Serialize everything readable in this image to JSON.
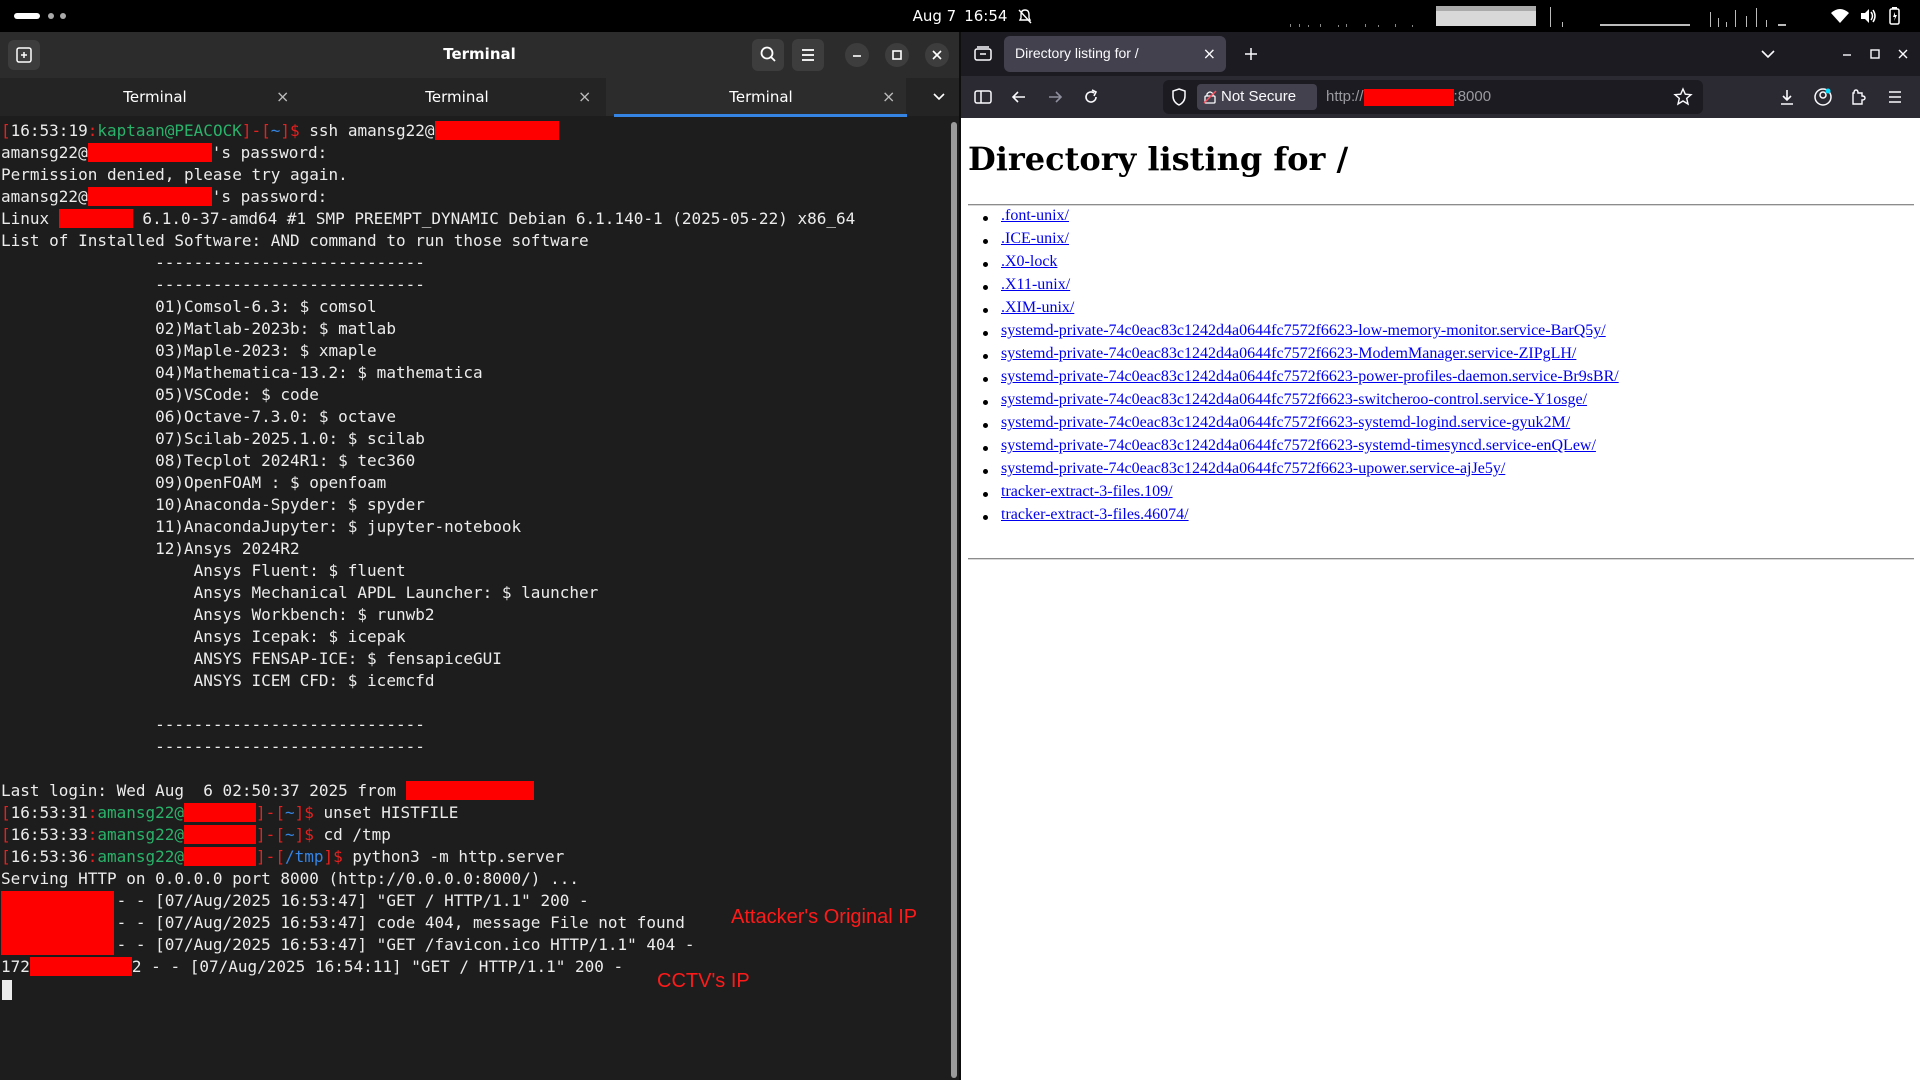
{
  "topbar": {
    "date": "Aug 7",
    "time": "16:54"
  },
  "terminal": {
    "window_title": "Terminal",
    "tabs": [
      {
        "label": "Terminal",
        "active": false
      },
      {
        "label": "Terminal",
        "active": false
      },
      {
        "label": "Terminal",
        "active": true
      }
    ],
    "prompt1": {
      "open": "[",
      "time": "16:53:19",
      "colon": ":",
      "user": "kaptaan@PEACOCK",
      "mid": "]-[",
      "dir": "~",
      "close": "]$",
      "cmd": " ssh amansg22@"
    },
    "lines": [
      "amansg22@",
      "'s password:",
      "Permission denied, please try again.",
      "amansg22@",
      "'s password:",
      "Linux ",
      " 6.1.0-37-amd64 #1 SMP PREEMPT_DYNAMIC Debian 6.1.140-1 (2025-05-22) x86_64",
      "List of Installed Software: AND command to run those software",
      "                ----------------------------",
      "                ----------------------------",
      "                01)Comsol-6.3: $ comsol",
      "                02)Matlab-2023b: $ matlab",
      "                03)Maple-2023: $ xmaple",
      "                04)Mathematica-13.2: $ mathematica",
      "                05)VSCode: $ code",
      "                06)Octave-7.3.0: $ octave",
      "                07)Scilab-2025.1.0: $ scilab",
      "                08)Tecplot 2024R1: $ tec360",
      "                09)OpenFOAM : $ openfoam",
      "                10)Anaconda-Spyder: $ spyder",
      "                11)AnacondaJupyter: $ jupyter-notebook",
      "                12)Ansys 2024R2",
      "                    Ansys Fluent: $ fluent",
      "                    Ansys Mechanical APDL Launcher: $ launcher",
      "                    Ansys Workbench: $ runwb2",
      "                    Ansys Icepak: $ icepak",
      "                    ANSYS FENSAP-ICE: $ fensapiceGUI",
      "                    ANSYS ICEM CFD: $ icemcfd",
      "                ----------------------------",
      "                ----------------------------",
      "Last login: Wed Aug  6 02:50:37 2025 from ",
      "Serving HTTP on 0.0.0.0 port 8000 (http://0.0.0.0:8000/) ...",
      "            - - [07/Aug/2025 16:53:47] \"GET / HTTP/1.1\" 200 -",
      "            - - [07/Aug/2025 16:53:47] code 404, message File not found",
      "            - - [07/Aug/2025 16:53:47] \"GET /favicon.ico HTTP/1.1\" 404 -",
      "172",
      "2 - - [07/Aug/2025 16:54:11] \"GET / HTTP/1.1\" 200 -"
    ],
    "prompt2": {
      "time": "16:53:31",
      "user": "amansg22@",
      "dir": "~",
      "cmd": " unset HISTFILE"
    },
    "prompt3": {
      "time": "16:53:33",
      "user": "amansg22@",
      "dir": "~",
      "cmd": " cd /tmp"
    },
    "prompt4": {
      "time": "16:53:36",
      "user": "amansg22@",
      "dir": "/tmp",
      "cmd": " python3 -m http.server"
    },
    "annotations": {
      "attacker": "Attacker's Original IP",
      "cctv": "CCTV's IP"
    }
  },
  "firefox": {
    "tab_title": "Directory listing for /",
    "not_secure": "Not Secure",
    "url_prefix": "http://",
    "url_suffix": ":8000",
    "page_heading": "Directory listing for /",
    "files": [
      ".font-unix/",
      ".ICE-unix/",
      ".X0-lock",
      ".X11-unix/",
      ".XIM-unix/",
      "systemd-private-74c0eac83c1242d4a0644fc7572f6623-low-memory-monitor.service-BarQ5y/",
      "systemd-private-74c0eac83c1242d4a0644fc7572f6623-ModemManager.service-ZIPgLH/",
      "systemd-private-74c0eac83c1242d4a0644fc7572f6623-power-profiles-daemon.service-Br9sBR/",
      "systemd-private-74c0eac83c1242d4a0644fc7572f6623-switcheroo-control.service-Y1osge/",
      "systemd-private-74c0eac83c1242d4a0644fc7572f6623-systemd-logind.service-gyuk2M/",
      "systemd-private-74c0eac83c1242d4a0644fc7572f6623-systemd-timesyncd.service-enQLew/",
      "systemd-private-74c0eac83c1242d4a0644fc7572f6623-upower.service-ajJe5y/",
      "tracker-extract-3-files.109/",
      "tracker-extract-3-files.46074/"
    ]
  },
  "colors": {
    "terminal_bg": "#1d1d1d",
    "prompt_bracket": "#e5201f",
    "prompt_user": "#29b36a",
    "prompt_dir": "#3584e4",
    "redaction": "#ff0000",
    "annotation": "#ff1a1a",
    "link": "#0000ee"
  }
}
